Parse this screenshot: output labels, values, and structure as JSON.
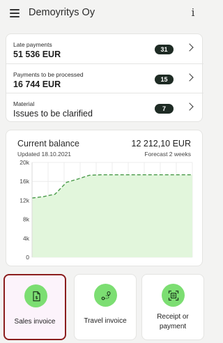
{
  "appbar": {
    "company_name": "Demoyritys Oy",
    "menu_icon": "hamburger-menu-icon",
    "info_icon": "info-icon"
  },
  "summary": {
    "rows": [
      {
        "label": "Late payments",
        "value": "51 536 EUR",
        "badge": "31"
      },
      {
        "label": "Payments to be processed",
        "value": "16 744 EUR",
        "badge": "15"
      },
      {
        "label": "Material",
        "value": "Issues to be clarified",
        "badge": "7"
      }
    ]
  },
  "balance": {
    "title": "Current balance",
    "amount": "12 212,10 EUR",
    "updated": "Updated 18.10.2021",
    "forecast_label": "Forecast 2 weeks"
  },
  "chart_data": {
    "type": "area",
    "title": "",
    "y_ticks": [
      "20k",
      "16k",
      "12k",
      "8k",
      "4k",
      "0"
    ],
    "ylim": [
      0,
      20000
    ],
    "grid": true,
    "x": [
      0,
      1,
      2,
      3,
      4,
      5,
      6,
      7,
      8,
      9,
      10,
      11,
      12,
      13,
      14
    ],
    "series": [
      {
        "values": [
          12500,
          12800,
          13300,
          15800,
          16500,
          17300,
          17400,
          17400,
          17400,
          17400,
          17400,
          17400,
          17400,
          17400,
          17400
        ]
      }
    ],
    "colors": {
      "line": "#4a9a4a",
      "fill": "#e2f6dc"
    }
  },
  "actions": [
    {
      "label": "Sales invoice",
      "icon": "sales-invoice-icon"
    },
    {
      "label": "Travel invoice",
      "icon": "travel-route-icon"
    },
    {
      "label": "Receipt or payment",
      "label_line1": "Receipt or",
      "label_line2": "payment",
      "icon": "receipt-scan-icon"
    }
  ],
  "colors": {
    "accent_green": "#7cde72",
    "badge_dark": "#1e2b24",
    "selected_border": "#8b1d1d"
  }
}
